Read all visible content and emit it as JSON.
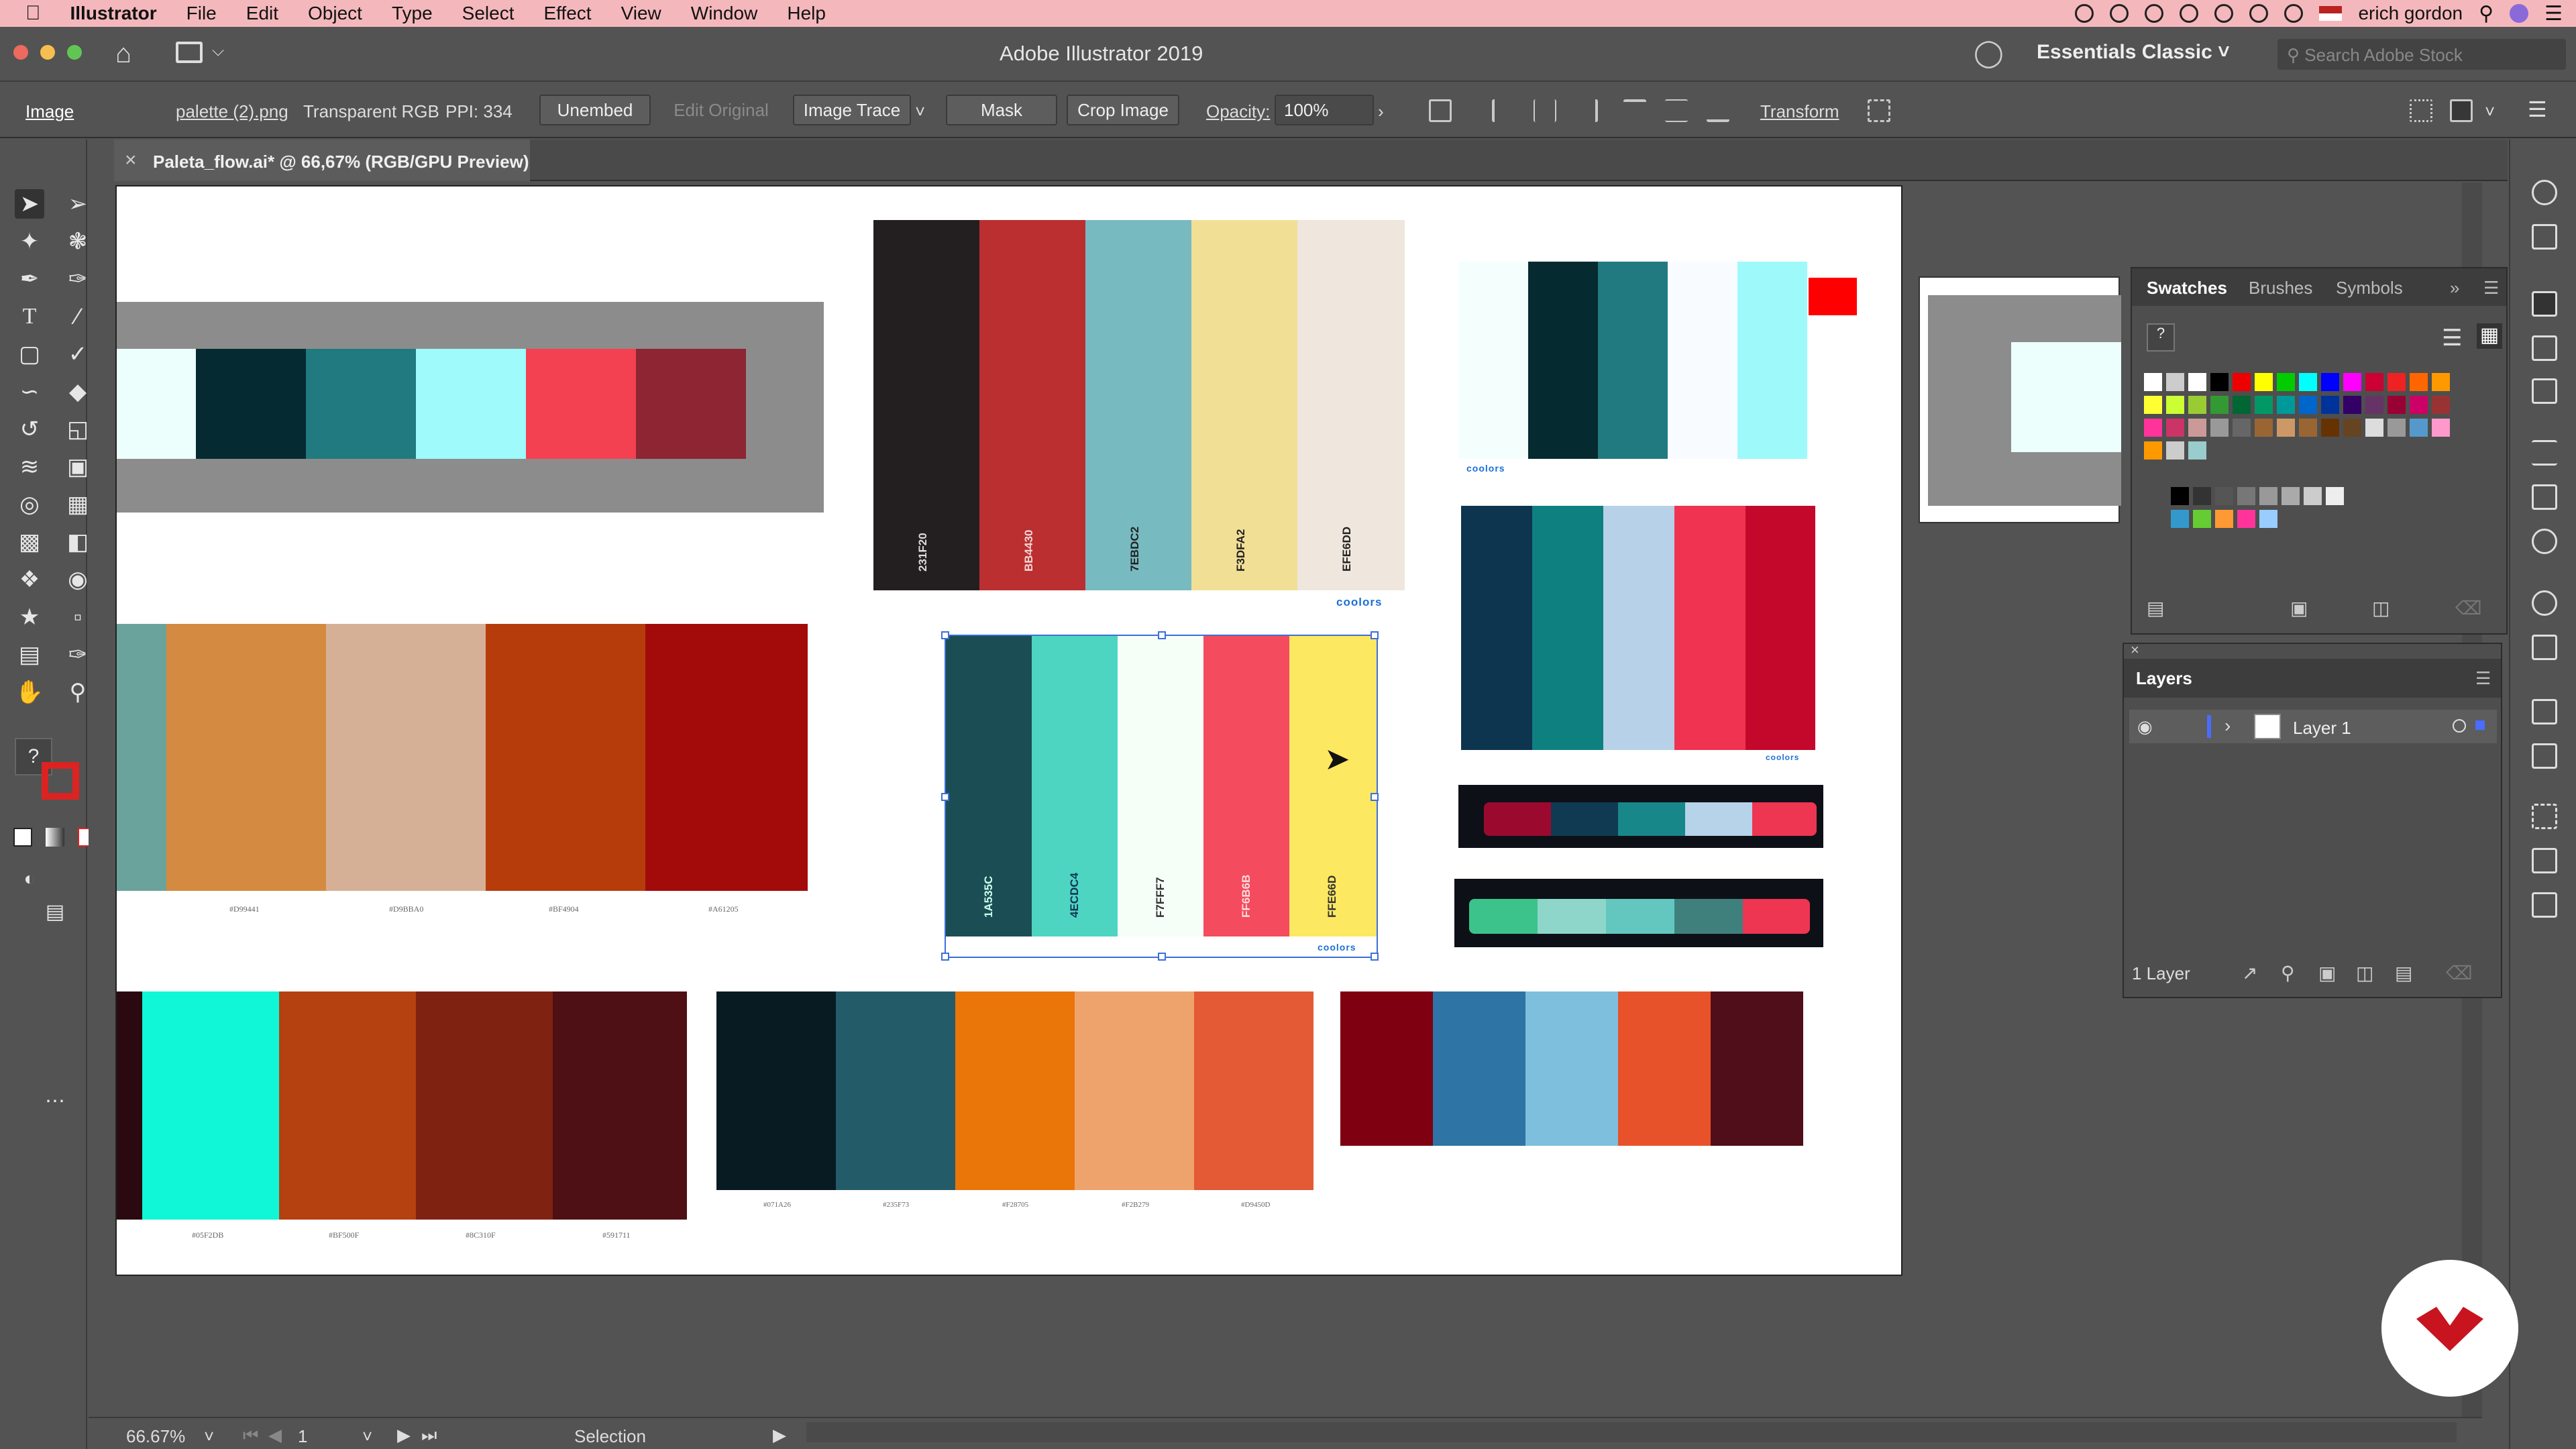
{
  "menubar": {
    "app": "Illustrator",
    "items": [
      "File",
      "Edit",
      "Object",
      "Type",
      "Select",
      "Effect",
      "View",
      "Window",
      "Help"
    ],
    "user": "erich gordon"
  },
  "titlebar": {
    "title": "Adobe Illustrator 2019",
    "workspace": "Essentials Classic",
    "search_placeholder": "Search Adobe Stock"
  },
  "control": {
    "selection_type": "Image",
    "file_link": "palette (2).png",
    "color_mode": "Transparent RGB",
    "ppi": "PPI: 334",
    "unembed": "Unembed",
    "edit_original": "Edit Original",
    "image_trace": "Image Trace",
    "mask": "Mask",
    "crop_image": "Crop Image",
    "opacity_label": "Opacity:",
    "opacity_value": "100%",
    "transform": "Transform"
  },
  "document": {
    "tab_title": "Paleta_flow.ai* @ 66,67% (RGB/GPU Preview)"
  },
  "palettes": {
    "p2_codes": [
      "231F20",
      "BB4430",
      "7EBDC2",
      "F3DFA2",
      "EFE6DD"
    ],
    "p3_labels": [
      "#D99441",
      "#D9BBA0",
      "#BF4904",
      "#A61205"
    ],
    "sel_codes": [
      "1A535C",
      "4ECDC4",
      "F7FFF7",
      "FF6B6B",
      "FFE66D"
    ],
    "p7_labels": [
      "#05F2DB",
      "#BF500F",
      "#8C310F",
      "#591711"
    ],
    "p8_labels": [
      "#071A26",
      "#235F73",
      "#F28705",
      "#F2B279",
      "#D9450D"
    ],
    "coolors": "coolors"
  },
  "colors": {
    "accent": "#3d6fd8",
    "menubar": "#f4b8bc"
  },
  "swatches_panel": {
    "tabs": [
      "Swatches",
      "Brushes",
      "Symbols"
    ]
  },
  "layers_panel": {
    "title": "Layers",
    "layer_name": "Layer 1",
    "count": "1 Layer"
  },
  "status": {
    "zoom": "66.67%",
    "artboard": "1",
    "tool": "Selection"
  }
}
